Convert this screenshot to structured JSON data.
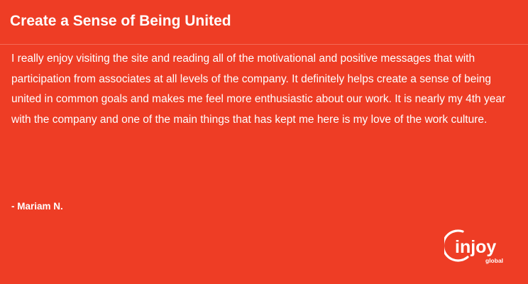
{
  "header": {
    "title": "Create a Sense of Being United"
  },
  "testimonial": {
    "message": "I really enjoy visiting the site and reading all of the motivational and positive messages that with participation from associates at all levels of the company. It definitely helps create a sense of being united in common goals and makes me feel more enthusiastic about our work. It is nearly my 4th year with the company and one of the main things that has kept me here is my love of the work culture.",
    "author": "- Mariam N."
  },
  "logo": {
    "name": "injoy",
    "tagline": "global"
  },
  "colors": {
    "background": "#ee3d25",
    "text": "#ffffff",
    "divider": "#f26a56"
  }
}
